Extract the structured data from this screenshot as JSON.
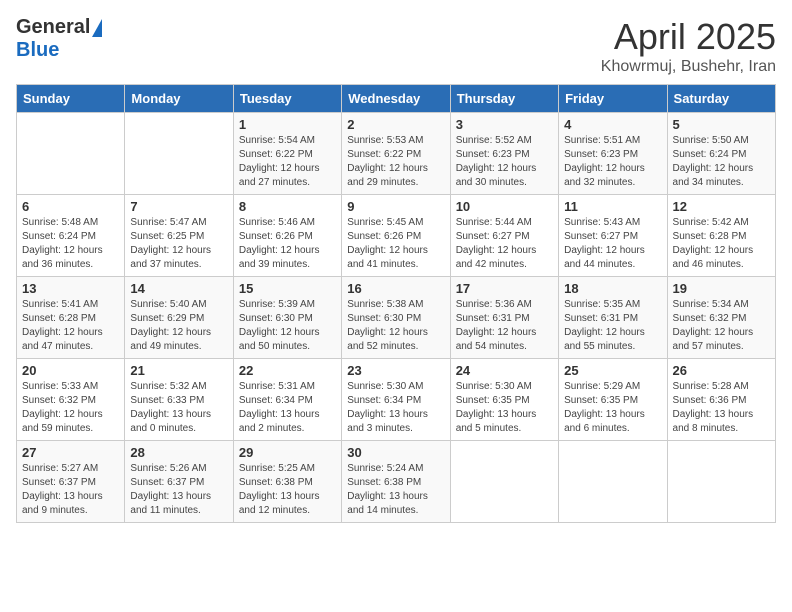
{
  "header": {
    "logo_general": "General",
    "logo_blue": "Blue",
    "title": "April 2025",
    "location": "Khowrmuj, Bushehr, Iran"
  },
  "weekdays": [
    "Sunday",
    "Monday",
    "Tuesday",
    "Wednesday",
    "Thursday",
    "Friday",
    "Saturday"
  ],
  "weeks": [
    [
      {
        "day": "",
        "sunrise": "",
        "sunset": "",
        "daylight": ""
      },
      {
        "day": "",
        "sunrise": "",
        "sunset": "",
        "daylight": ""
      },
      {
        "day": "1",
        "sunrise": "Sunrise: 5:54 AM",
        "sunset": "Sunset: 6:22 PM",
        "daylight": "Daylight: 12 hours and 27 minutes."
      },
      {
        "day": "2",
        "sunrise": "Sunrise: 5:53 AM",
        "sunset": "Sunset: 6:22 PM",
        "daylight": "Daylight: 12 hours and 29 minutes."
      },
      {
        "day": "3",
        "sunrise": "Sunrise: 5:52 AM",
        "sunset": "Sunset: 6:23 PM",
        "daylight": "Daylight: 12 hours and 30 minutes."
      },
      {
        "day": "4",
        "sunrise": "Sunrise: 5:51 AM",
        "sunset": "Sunset: 6:23 PM",
        "daylight": "Daylight: 12 hours and 32 minutes."
      },
      {
        "day": "5",
        "sunrise": "Sunrise: 5:50 AM",
        "sunset": "Sunset: 6:24 PM",
        "daylight": "Daylight: 12 hours and 34 minutes."
      }
    ],
    [
      {
        "day": "6",
        "sunrise": "Sunrise: 5:48 AM",
        "sunset": "Sunset: 6:24 PM",
        "daylight": "Daylight: 12 hours and 36 minutes."
      },
      {
        "day": "7",
        "sunrise": "Sunrise: 5:47 AM",
        "sunset": "Sunset: 6:25 PM",
        "daylight": "Daylight: 12 hours and 37 minutes."
      },
      {
        "day": "8",
        "sunrise": "Sunrise: 5:46 AM",
        "sunset": "Sunset: 6:26 PM",
        "daylight": "Daylight: 12 hours and 39 minutes."
      },
      {
        "day": "9",
        "sunrise": "Sunrise: 5:45 AM",
        "sunset": "Sunset: 6:26 PM",
        "daylight": "Daylight: 12 hours and 41 minutes."
      },
      {
        "day": "10",
        "sunrise": "Sunrise: 5:44 AM",
        "sunset": "Sunset: 6:27 PM",
        "daylight": "Daylight: 12 hours and 42 minutes."
      },
      {
        "day": "11",
        "sunrise": "Sunrise: 5:43 AM",
        "sunset": "Sunset: 6:27 PM",
        "daylight": "Daylight: 12 hours and 44 minutes."
      },
      {
        "day": "12",
        "sunrise": "Sunrise: 5:42 AM",
        "sunset": "Sunset: 6:28 PM",
        "daylight": "Daylight: 12 hours and 46 minutes."
      }
    ],
    [
      {
        "day": "13",
        "sunrise": "Sunrise: 5:41 AM",
        "sunset": "Sunset: 6:28 PM",
        "daylight": "Daylight: 12 hours and 47 minutes."
      },
      {
        "day": "14",
        "sunrise": "Sunrise: 5:40 AM",
        "sunset": "Sunset: 6:29 PM",
        "daylight": "Daylight: 12 hours and 49 minutes."
      },
      {
        "day": "15",
        "sunrise": "Sunrise: 5:39 AM",
        "sunset": "Sunset: 6:30 PM",
        "daylight": "Daylight: 12 hours and 50 minutes."
      },
      {
        "day": "16",
        "sunrise": "Sunrise: 5:38 AM",
        "sunset": "Sunset: 6:30 PM",
        "daylight": "Daylight: 12 hours and 52 minutes."
      },
      {
        "day": "17",
        "sunrise": "Sunrise: 5:36 AM",
        "sunset": "Sunset: 6:31 PM",
        "daylight": "Daylight: 12 hours and 54 minutes."
      },
      {
        "day": "18",
        "sunrise": "Sunrise: 5:35 AM",
        "sunset": "Sunset: 6:31 PM",
        "daylight": "Daylight: 12 hours and 55 minutes."
      },
      {
        "day": "19",
        "sunrise": "Sunrise: 5:34 AM",
        "sunset": "Sunset: 6:32 PM",
        "daylight": "Daylight: 12 hours and 57 minutes."
      }
    ],
    [
      {
        "day": "20",
        "sunrise": "Sunrise: 5:33 AM",
        "sunset": "Sunset: 6:32 PM",
        "daylight": "Daylight: 12 hours and 59 minutes."
      },
      {
        "day": "21",
        "sunrise": "Sunrise: 5:32 AM",
        "sunset": "Sunset: 6:33 PM",
        "daylight": "Daylight: 13 hours and 0 minutes."
      },
      {
        "day": "22",
        "sunrise": "Sunrise: 5:31 AM",
        "sunset": "Sunset: 6:34 PM",
        "daylight": "Daylight: 13 hours and 2 minutes."
      },
      {
        "day": "23",
        "sunrise": "Sunrise: 5:30 AM",
        "sunset": "Sunset: 6:34 PM",
        "daylight": "Daylight: 13 hours and 3 minutes."
      },
      {
        "day": "24",
        "sunrise": "Sunrise: 5:30 AM",
        "sunset": "Sunset: 6:35 PM",
        "daylight": "Daylight: 13 hours and 5 minutes."
      },
      {
        "day": "25",
        "sunrise": "Sunrise: 5:29 AM",
        "sunset": "Sunset: 6:35 PM",
        "daylight": "Daylight: 13 hours and 6 minutes."
      },
      {
        "day": "26",
        "sunrise": "Sunrise: 5:28 AM",
        "sunset": "Sunset: 6:36 PM",
        "daylight": "Daylight: 13 hours and 8 minutes."
      }
    ],
    [
      {
        "day": "27",
        "sunrise": "Sunrise: 5:27 AM",
        "sunset": "Sunset: 6:37 PM",
        "daylight": "Daylight: 13 hours and 9 minutes."
      },
      {
        "day": "28",
        "sunrise": "Sunrise: 5:26 AM",
        "sunset": "Sunset: 6:37 PM",
        "daylight": "Daylight: 13 hours and 11 minutes."
      },
      {
        "day": "29",
        "sunrise": "Sunrise: 5:25 AM",
        "sunset": "Sunset: 6:38 PM",
        "daylight": "Daylight: 13 hours and 12 minutes."
      },
      {
        "day": "30",
        "sunrise": "Sunrise: 5:24 AM",
        "sunset": "Sunset: 6:38 PM",
        "daylight": "Daylight: 13 hours and 14 minutes."
      },
      {
        "day": "",
        "sunrise": "",
        "sunset": "",
        "daylight": ""
      },
      {
        "day": "",
        "sunrise": "",
        "sunset": "",
        "daylight": ""
      },
      {
        "day": "",
        "sunrise": "",
        "sunset": "",
        "daylight": ""
      }
    ]
  ]
}
